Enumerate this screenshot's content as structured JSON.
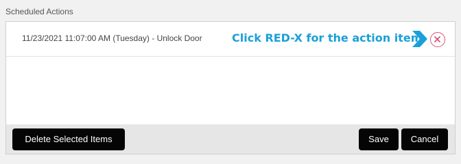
{
  "section": {
    "title": "Scheduled Actions"
  },
  "actions": [
    {
      "text": "11/23/2021 11:07:00 AM (Tuesday) - Unlock Door"
    }
  ],
  "annotation": {
    "text": "Click RED-X for the action item.",
    "color": "#1aa0d8"
  },
  "icons": {
    "remove": "close-circle-icon",
    "pointer": "arrow-right-icon"
  },
  "colors": {
    "remove_icon": "#d9537c",
    "button_bg": "#050505"
  },
  "footer": {
    "delete_label": "Delete Selected Items",
    "save_label": "Save",
    "cancel_label": "Cancel"
  }
}
